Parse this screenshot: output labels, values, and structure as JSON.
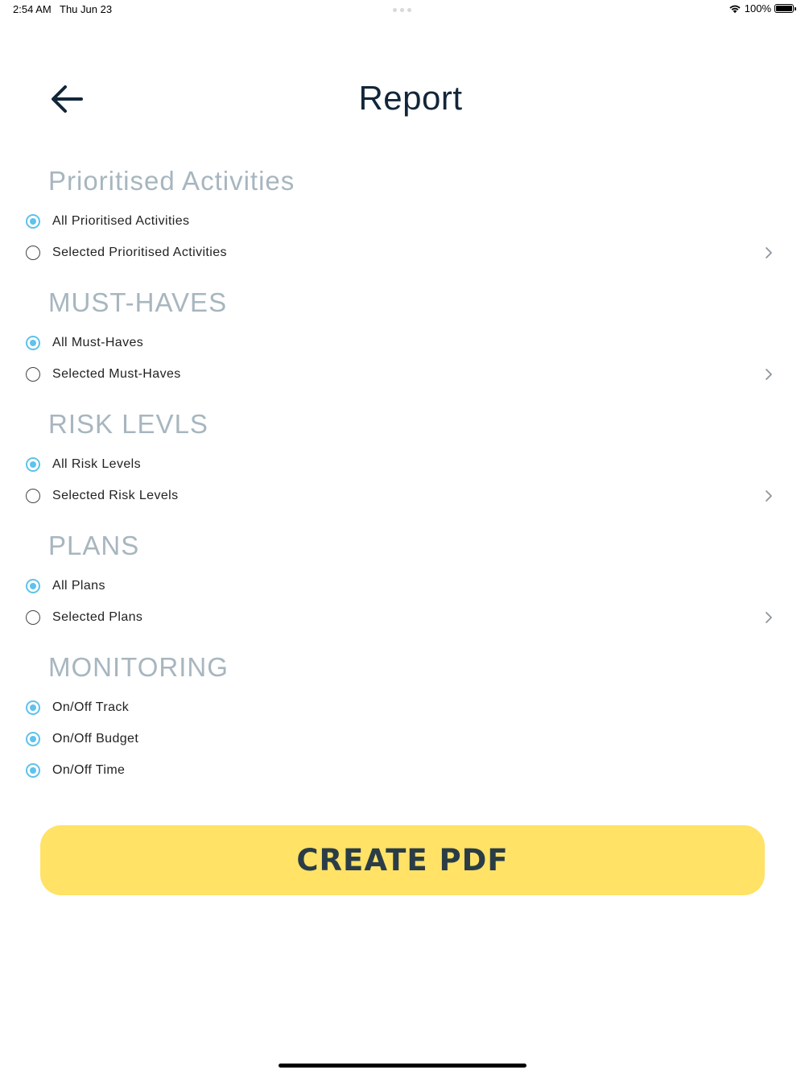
{
  "status_bar": {
    "time": "2:54 AM",
    "date": "Thu Jun 23",
    "battery": "100%"
  },
  "header": {
    "title": "Report",
    "back_icon": "arrow-left-icon"
  },
  "colors": {
    "accent": "#5ec2ec",
    "section_title": "#a7b6bf",
    "button_bg": "#ffe266",
    "button_text": "#2a3d47",
    "title": "#12263a"
  },
  "sections": [
    {
      "title": "Prioritised Activities",
      "options": [
        {
          "label": "All Prioritised Activities",
          "selected": true,
          "has_chevron": false
        },
        {
          "label": "Selected Prioritised Activities",
          "selected": false,
          "has_chevron": true
        }
      ]
    },
    {
      "title": "MUST-HAVES",
      "options": [
        {
          "label": "All Must-Haves",
          "selected": true,
          "has_chevron": false
        },
        {
          "label": "Selected Must-Haves",
          "selected": false,
          "has_chevron": true
        }
      ]
    },
    {
      "title": "RISK LEVLS",
      "options": [
        {
          "label": "All Risk Levels",
          "selected": true,
          "has_chevron": false
        },
        {
          "label": "Selected Risk Levels",
          "selected": false,
          "has_chevron": true
        }
      ]
    },
    {
      "title": "PLANS",
      "options": [
        {
          "label": "All Plans",
          "selected": true,
          "has_chevron": false
        },
        {
          "label": "Selected Plans",
          "selected": false,
          "has_chevron": true
        }
      ]
    },
    {
      "title": "MONITORING",
      "options": [
        {
          "label": "On/Off Track",
          "selected": true,
          "has_chevron": false
        },
        {
          "label": "On/Off Budget",
          "selected": true,
          "has_chevron": false
        },
        {
          "label": "On/Off Time",
          "selected": true,
          "has_chevron": false
        }
      ]
    }
  ],
  "actions": {
    "create_pdf_label": "CREATE PDF"
  }
}
